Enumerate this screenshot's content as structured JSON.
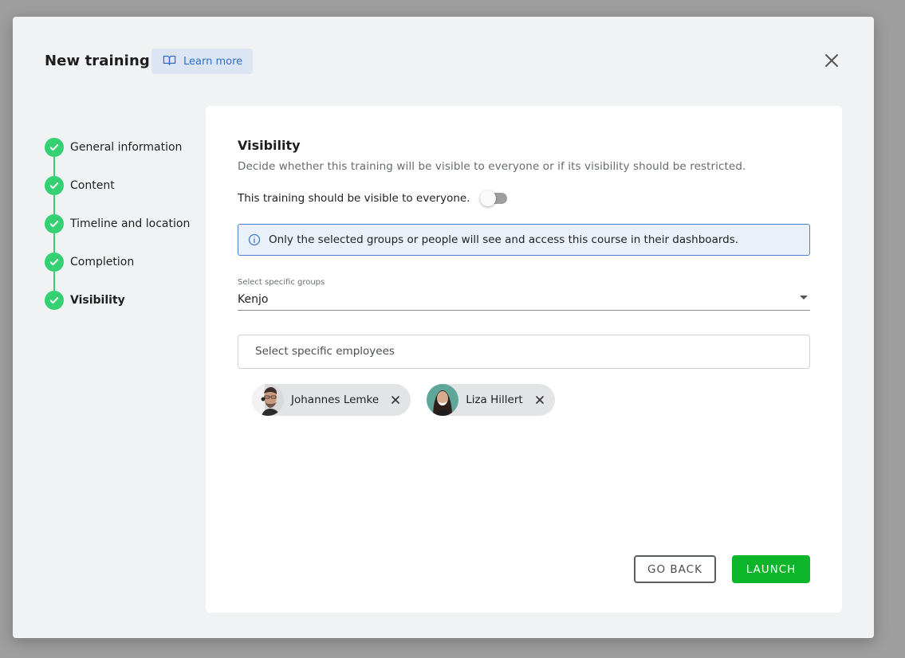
{
  "modal": {
    "title": "New training",
    "learn_more_label": "Learn more",
    "learn_more_icon": "open-book-icon",
    "close_icon": "close-icon"
  },
  "steps": [
    {
      "label": "General information",
      "status": "done",
      "icon": "check-icon"
    },
    {
      "label": "Content",
      "status": "done",
      "icon": "check-icon"
    },
    {
      "label": "Timeline and location",
      "status": "done",
      "icon": "check-icon"
    },
    {
      "label": "Completion",
      "status": "done",
      "icon": "check-icon"
    },
    {
      "label": "Visibility",
      "status": "done",
      "active": true,
      "icon": "check-icon"
    }
  ],
  "visibility": {
    "title": "Visibility",
    "description": "Decide whether this training will be visible to everyone or if its visibility should be restricted.",
    "toggle_label": "This training should be visible to everyone.",
    "toggle_on": false,
    "info_text": "Only the selected groups or people will see and access this course in their dashboards.",
    "info_icon": "info-icon",
    "groups_label": "Select specific groups",
    "groups_value": "Kenjo",
    "employees_placeholder": "Select specific employees",
    "selected_employees": [
      {
        "name": "Johannes Lemke",
        "remove_icon": "close-icon"
      },
      {
        "name": "Liza Hillert",
        "remove_icon": "close-icon"
      }
    ]
  },
  "actions": {
    "back_label": "GO BACK",
    "launch_label": "LAUNCH"
  },
  "colors": {
    "accent_green": "#35d072",
    "launch_green": "#0cb52a",
    "info_blue": "#4a84d0",
    "link_blue": "#2f6fc5"
  }
}
